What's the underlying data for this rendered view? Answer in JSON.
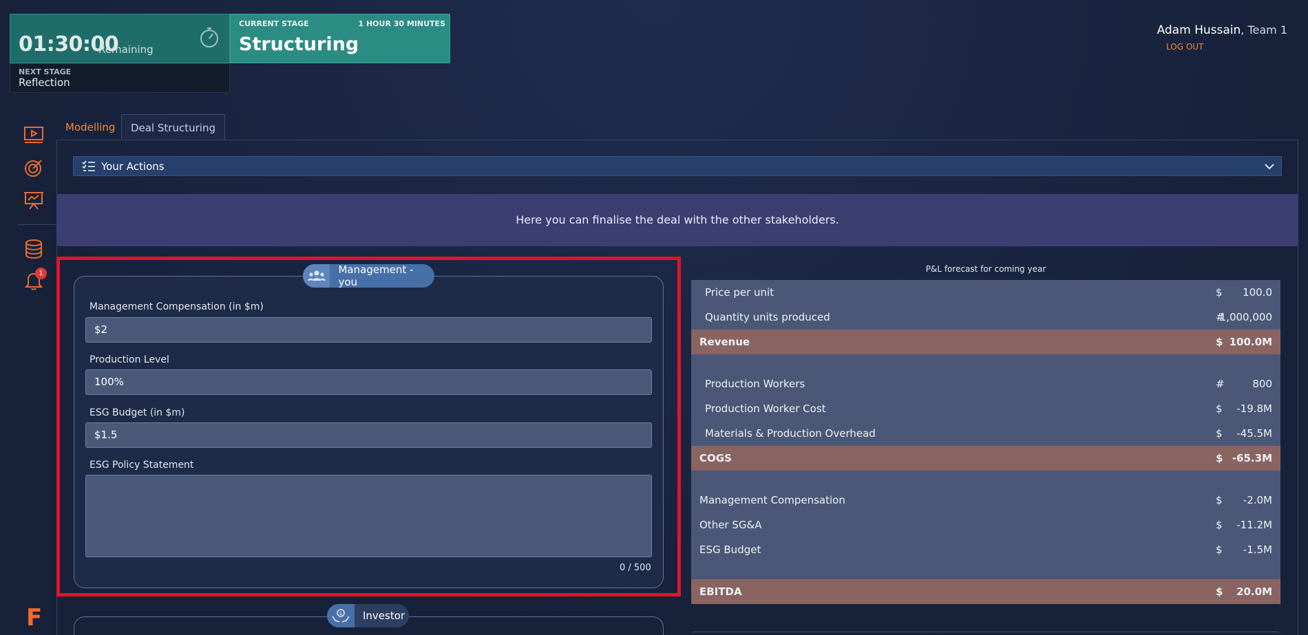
{
  "timer": {
    "time": "01:30:00",
    "remaining_label": "Remaining",
    "next_stage_label": "NEXT STAGE",
    "next_stage": "Reflection"
  },
  "stage": {
    "label": "CURRENT STAGE",
    "duration": "1 HOUR 30 MINUTES",
    "name": "Structuring"
  },
  "user": {
    "name": "Adam Hussain",
    "team": ", Team 1",
    "logout": "LOG OUT"
  },
  "sidebar": {
    "notifications_badge": "1",
    "logo": "F"
  },
  "tabs": [
    {
      "label": "Modelling",
      "active": false
    },
    {
      "label": "Deal Structuring",
      "active": true
    }
  ],
  "actions": {
    "label": "Your Actions"
  },
  "banner": {
    "text": "Here you can finalise the deal with the other stakeholders."
  },
  "management": {
    "title": "Management - you",
    "fields": {
      "compensation": {
        "label": "Management Compensation (in $m)",
        "value": "$2"
      },
      "production": {
        "label": "Production Level",
        "value": "100%"
      },
      "esg_budget": {
        "label": "ESG Budget (in $m)",
        "value": "$1.5"
      },
      "esg_policy": {
        "label": "ESG Policy Statement",
        "value": ""
      }
    },
    "char_count": "0 / 500"
  },
  "investor": {
    "title": "Investor"
  },
  "pl": {
    "title": "P&L forecast for coming year",
    "rows": [
      {
        "label": "Price per unit",
        "cur": "$",
        "value": "100.0"
      },
      {
        "label": "Quantity units produced",
        "cur": "#",
        "value": "1,000,000"
      },
      {
        "label": "Revenue",
        "cur": "$",
        "value": "100.0M"
      },
      {
        "label": "Production Workers",
        "cur": "#",
        "value": "800"
      },
      {
        "label": "Production Worker Cost",
        "cur": "$",
        "value": "-19.8M"
      },
      {
        "label": "Materials & Production Overhead",
        "cur": "$",
        "value": "-45.5M"
      },
      {
        "label": "COGS",
        "cur": "$",
        "value": "-65.3M"
      },
      {
        "label": "Management Compensation",
        "cur": "$",
        "value": "-2.0M"
      },
      {
        "label": "Other SG&A",
        "cur": "$",
        "value": "-11.2M"
      },
      {
        "label": "ESG Budget",
        "cur": "$",
        "value": "-1.5M"
      },
      {
        "label": "EBITDA",
        "cur": "$",
        "value": "20.0M"
      }
    ]
  },
  "colors": {
    "accent_orange": "#f08a3c",
    "timer_bg": "#1f6d6a",
    "stage_bg": "#2a8c82",
    "highlight_red": "#e3132c",
    "total_row": "#8a6461"
  }
}
